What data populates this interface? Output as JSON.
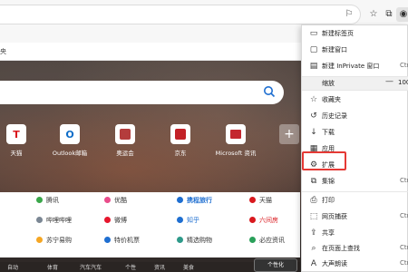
{
  "toolbar": {
    "read_aloud_icon": "reading-icon",
    "favorites_icon": "star-outline-icon",
    "collections_icon": "collections-icon",
    "profile_icon": "profile-icon"
  },
  "favorites_bar": {
    "item": "央"
  },
  "ntp": {
    "tiles": [
      {
        "label": "天猫",
        "glyph": "T",
        "color": "#d9191e"
      },
      {
        "label": "Outlook邮箱",
        "glyph": "O",
        "color": "#0e6dc8"
      },
      {
        "label": "奥运会",
        "glyph": "",
        "color": "#b43c3c"
      },
      {
        "label": "京东",
        "glyph": "",
        "color": "#c32127"
      },
      {
        "label": "Microsoft 资讯",
        "glyph": "",
        "color": "#c4272f"
      }
    ],
    "add_tile": "+",
    "links": [
      [
        "腾讯",
        "优酷",
        "携程旅行",
        "天猫"
      ],
      [
        "哔哩哔哩",
        "微博",
        "知乎",
        "六间房"
      ],
      [
        "苏宁易购",
        "特价机票",
        "精选购物",
        "必应资讯"
      ]
    ],
    "bottom": [
      "自动",
      "体育",
      "汽车汽车",
      "个性",
      "资讯",
      "美食"
    ],
    "bottom_button": "个性化"
  },
  "menu": {
    "new_tab": "新建标签页",
    "new_window": "新建窗口",
    "new_inprivate": "新建 InPrivate 窗口",
    "new_inprivate_shortcut": "Ctr",
    "zoom_label": "缩放",
    "zoom_minus": "—",
    "zoom_value": "100%",
    "favorites": "收藏夹",
    "history": "历史记录",
    "downloads": "下载",
    "apps": "应用",
    "extensions": "扩展",
    "collections": "集锦",
    "collections_shortcut": "Ctr",
    "print": "打印",
    "web_capture": "网页捕获",
    "web_capture_shortcut": "Ctr",
    "share": "共享",
    "find_on_page": "在页面上查找",
    "find_shortcut": "Ctr",
    "read_aloud": "大声朗读",
    "read_aloud_shortcut": "Ctr"
  },
  "colors": {
    "highlight": "#e53935",
    "link_blue": "#1f6fd1"
  }
}
